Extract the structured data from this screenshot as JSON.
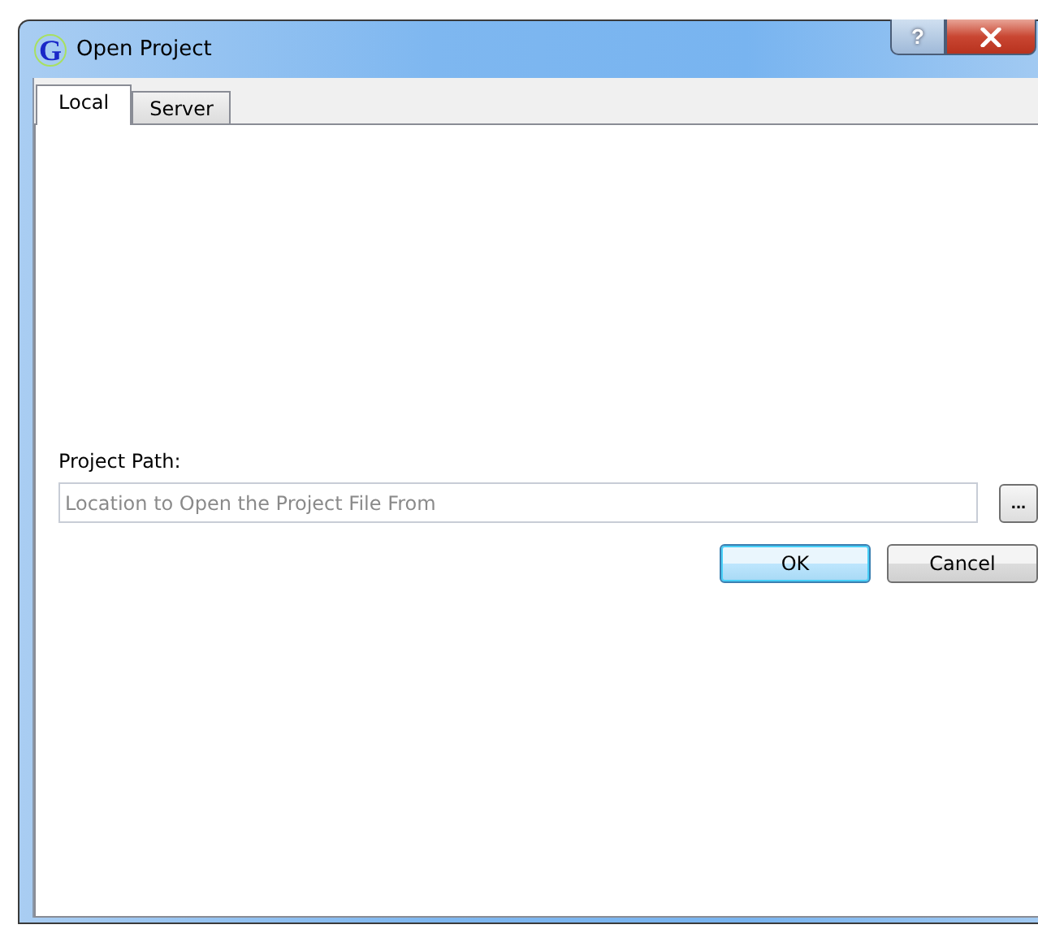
{
  "window": {
    "title": "Open Project",
    "logo_letter": "G",
    "help_button": "?"
  },
  "tabs": [
    {
      "label": "Local",
      "selected": true
    },
    {
      "label": "Server",
      "selected": false
    }
  ],
  "project_path": {
    "label": "Project Path:",
    "placeholder": "Location to Open the Project File From",
    "browse_button": "..."
  },
  "buttons": [
    {
      "label": "OK",
      "default": true
    },
    {
      "label": "Cancel",
      "default": false
    }
  ]
}
